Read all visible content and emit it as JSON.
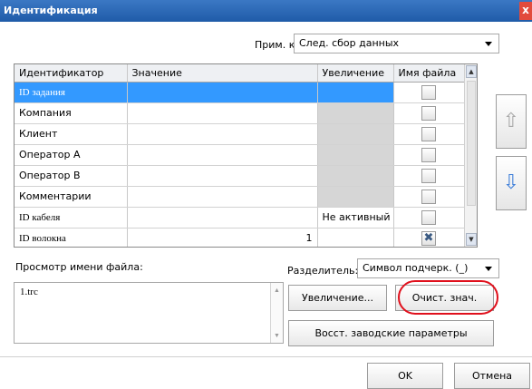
{
  "window": {
    "title": "Идентификация",
    "close_label": "x"
  },
  "apply_to": {
    "label": "Прим. к:",
    "value": "След. сбор данных"
  },
  "grid": {
    "columns": [
      "Идентификатор",
      "Значение",
      "Увеличение",
      "Имя файла"
    ],
    "rows": [
      {
        "id": "ID задания",
        "value": "",
        "zoom": "",
        "zoom_active": false,
        "filename": false,
        "selected": true
      },
      {
        "id": "Компания",
        "value": "",
        "zoom": "",
        "zoom_active": false,
        "filename": false,
        "selected": false
      },
      {
        "id": "Клиент",
        "value": "",
        "zoom": "",
        "zoom_active": false,
        "filename": false,
        "selected": false
      },
      {
        "id": "Оператор A",
        "value": "",
        "zoom": "",
        "zoom_active": false,
        "filename": false,
        "selected": false
      },
      {
        "id": "Оператор B",
        "value": "",
        "zoom": "",
        "zoom_active": false,
        "filename": false,
        "selected": false
      },
      {
        "id": "Комментарии",
        "value": "",
        "zoom": "",
        "zoom_active": false,
        "filename": false,
        "selected": false
      },
      {
        "id": "ID кабеля",
        "value": "",
        "zoom": "Не активный",
        "zoom_active": true,
        "filename": false,
        "selected": false
      },
      {
        "id": "ID волокна",
        "value": "1",
        "zoom": "",
        "zoom_active": true,
        "filename": true,
        "selected": false
      }
    ]
  },
  "checkbox_mark": "✖",
  "icons": {
    "up": "arrow-up-icon",
    "down": "arrow-down-icon"
  },
  "preview": {
    "label": "Просмотр имени файла:",
    "text": "1.trc"
  },
  "separator": {
    "label": "Разделитель:",
    "value": "Символ подчерк. (_)"
  },
  "buttons": {
    "zoom": "Увеличение...",
    "clear": "Очист. знач.",
    "restore": "Восст. заводские параметры",
    "ok": "OK",
    "cancel": "Отмена"
  },
  "colors": {
    "title_bar": "#2a67b5",
    "selection": "#3399ff",
    "highlight": "#e0101c"
  }
}
